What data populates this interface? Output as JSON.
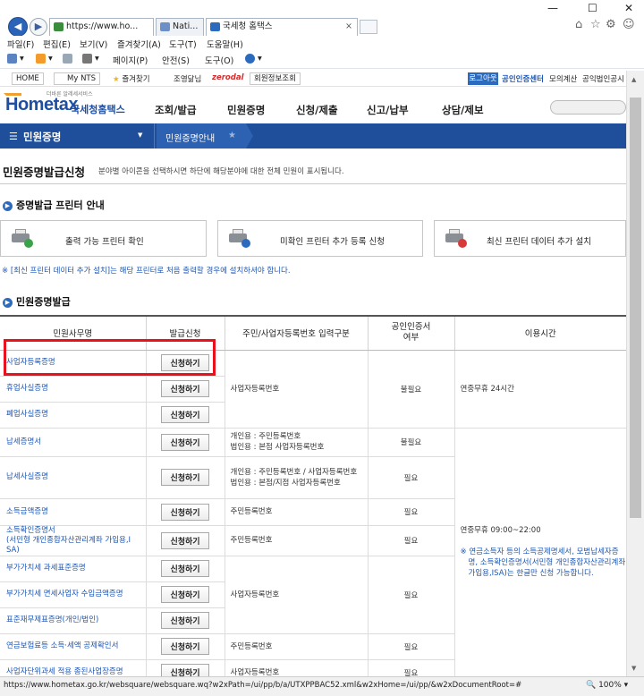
{
  "browser": {
    "address_tab": "https://www.ho...",
    "other_tab": "Nati...",
    "active_tab": "국세청 홈택스",
    "menu": [
      "파일(F)",
      "편집(E)",
      "보기(V)",
      "즐겨찾기(A)",
      "도구(T)",
      "도움말(H)"
    ],
    "commands": [
      "페이지(P)",
      "안전(S)",
      "도구(O)"
    ],
    "status_url": "https://www.hometax.go.kr/websquare/websquare.wq?w2xPath=/ui/pp/b/a/UTXPPBAC52.xml&w2xHome=/ui/pp/&w2xDocumentRoot=#",
    "zoom": "100%"
  },
  "util": {
    "home": "HOME",
    "mynts": "My NTS",
    "favorites": "즐겨찾기",
    "search": "조영닮님",
    "zerodal": "zerodal",
    "member_info": "회원정보조회",
    "logout": "로그아웃",
    "cert_center": "공인인증센터",
    "mock_tax": "모의계산",
    "public_notice": "공익법인공시"
  },
  "header": {
    "slogan": "더바른 알레세서비스",
    "logo": "Hometax",
    "logo_sub": "국세청홈택스",
    "nav": [
      "조회/발급",
      "민원증명",
      "신청/제출",
      "신고/납부",
      "상담/제보"
    ]
  },
  "bluebar": {
    "menu_label": "민원증명",
    "breadcrumb": "민원증명안내"
  },
  "page": {
    "title": "민원증명발급신청",
    "desc": "분야별 아이콘을 선택하시면 하단에 해당분야에 대한 전체 민원이 표시됩니다.",
    "printer_section": "증명발급 프린터 안내",
    "printer_buttons": [
      "출력 가능 프린터 확인",
      "미확인 프린터 추가 등록 신청",
      "최신 프린터 데이터 추가 설치"
    ],
    "notice": "※ [최신 프린터 데이터 추가 설치]는 해당 프린터로 처음 출력할 경우에 설치하셔야 합니다.",
    "issue_section": "민원증명발급"
  },
  "table": {
    "headers": [
      "민원사무명",
      "발급신청",
      "주민/사업자등록번호 입력구분",
      "공인인증서\n여부",
      "이용시간"
    ],
    "apply_label": "신청하기",
    "rows": [
      {
        "name": "사업자등록증명"
      },
      {
        "name": "휴업사실증명",
        "id_type": "사업자등록번호",
        "cert": "불필요",
        "time": "연중무휴 24시간"
      },
      {
        "name": "폐업사실증명"
      },
      {
        "name": "납세증명서",
        "id_type": "개인용 : 주민등록번호\n법인용 : 본점 사업자등록번호",
        "cert": "불필요"
      },
      {
        "name": "납세사실증명",
        "id_type": "개인용 : 주민등록번호 / 사업자등록번호\n법인용 : 본점/지점 사업자등록번호",
        "cert": "필요"
      },
      {
        "name": "소득금액증명",
        "id_type": "주민등록번호",
        "cert": "필요"
      },
      {
        "name": "소득확인증명서\n(서민형 개인종합자산관리계좌 가입용,I SA)",
        "id_type": "주민등록번호",
        "cert": "필요"
      },
      {
        "name": "부가가치세 과세표준증명"
      },
      {
        "name": "부가가치세 면세사업자 수입금액증명",
        "id_type": "사업자등록번호",
        "cert": "필요"
      },
      {
        "name": "표준재무제표증명(개인/법인)"
      },
      {
        "name": "연금보험료등 소득·세액 공제확인서",
        "id_type": "주민등록번호",
        "cert": "필요"
      },
      {
        "name": "사업자단위과세 적용 종된사업장증명",
        "id_type": "사업자등록번호",
        "cert": "필요"
      }
    ],
    "time_group2": "연중무휴 09:00~22:00",
    "time_group2_note": "※ 연금소득자 등의 소득공제명세서, 모범납세자증명, 소득확인증명서(서민형 개인종합자산관리계좌 가입용,ISA)는 한글만 신청 가능합니다."
  }
}
